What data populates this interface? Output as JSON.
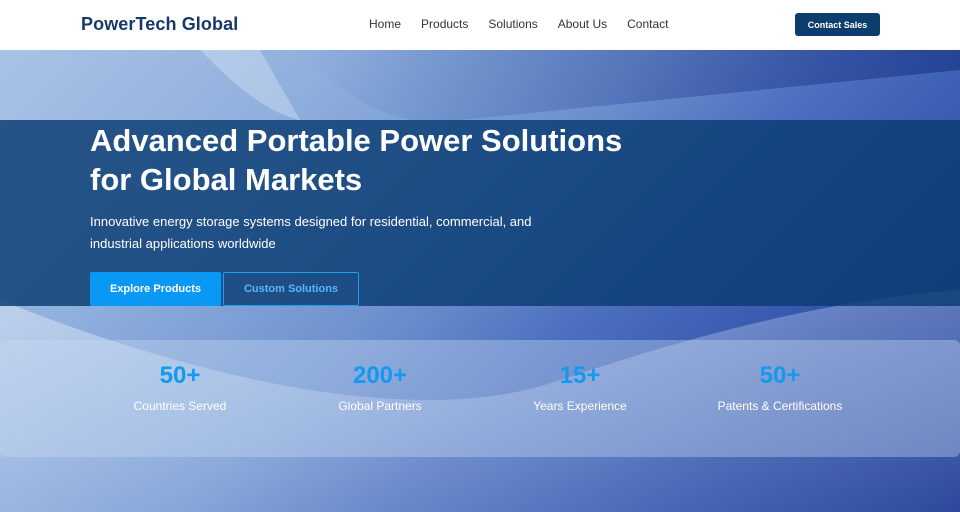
{
  "nav": {
    "brand": "PowerTech Global",
    "links": [
      "Home",
      "Products",
      "Solutions",
      "About Us",
      "Contact"
    ],
    "cta_label": "Contact Sales"
  },
  "hero": {
    "title": "Advanced Portable Power Solutions for Global Markets",
    "subtitle": "Innovative energy storage systems designed for residential, commercial, and industrial applications worldwide",
    "primary_button": "Explore Products",
    "secondary_button": "Custom Solutions"
  },
  "stats": [
    {
      "value": "50+",
      "label": "Countries Served"
    },
    {
      "value": "200+",
      "label": "Global Partners"
    },
    {
      "value": "15+",
      "label": "Years Experience"
    },
    {
      "value": "50+",
      "label": "Patents & Certifications"
    }
  ],
  "colors": {
    "brand": "#163a66",
    "cta": "#0d3d6d",
    "accent": "#0a98f5",
    "stat_number": "#1299f0"
  }
}
